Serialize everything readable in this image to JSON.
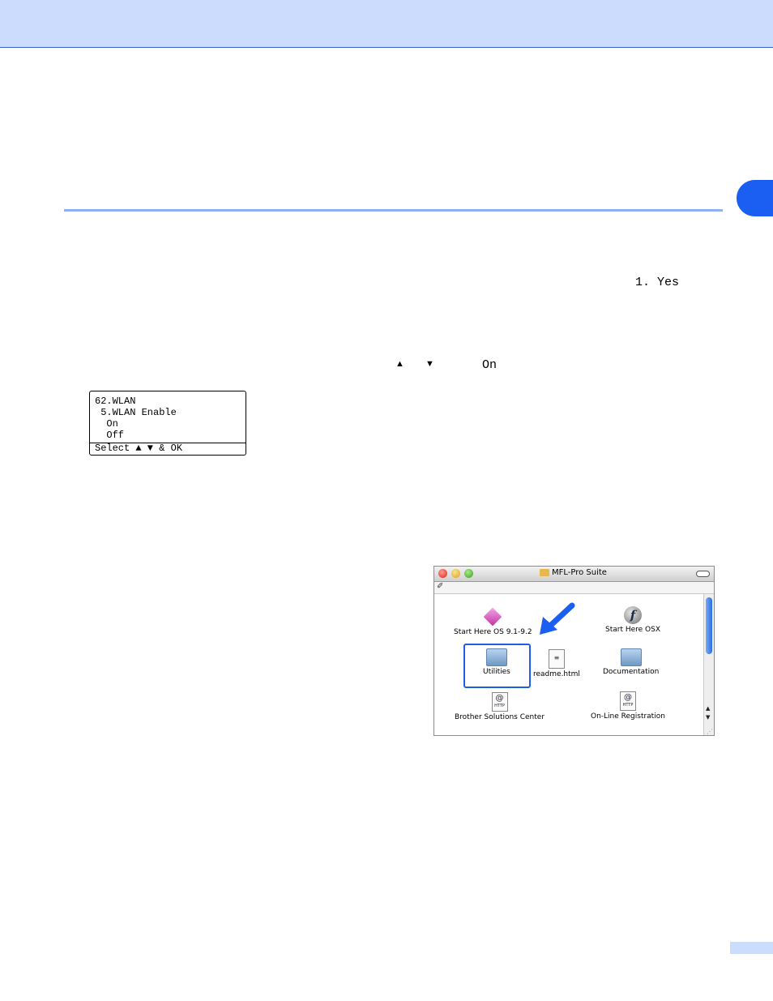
{
  "body": {
    "option_text": "1. Yes",
    "arrow_up": "▲",
    "arrow_down": "▼",
    "on_text": "On"
  },
  "lcd": {
    "line1": "62.WLAN",
    "line2": " 5.WLAN Enable",
    "line3": "  On",
    "line4": "  Off",
    "footer": "Select ▲ ▼ & OK"
  },
  "finder": {
    "window_title": "MFL-Pro Suite",
    "items": [
      {
        "label": "Start Here OS 9.1-9.2",
        "icon": "installer-diamond-icon"
      },
      {
        "label": "Start Here OSX",
        "icon": "flash-f-icon"
      },
      {
        "label": "Utilities",
        "icon": "folder-icon",
        "selected": true
      },
      {
        "label": "readme.html",
        "icon": "document-icon"
      },
      {
        "label": "Documentation",
        "icon": "folder-icon"
      },
      {
        "label": "Brother Solutions Center",
        "icon": "http-link-icon"
      },
      {
        "label": "On-Line Registration",
        "icon": "http-link-icon"
      }
    ],
    "http_icon_text": "@",
    "http_icon_sub": "HTTP"
  },
  "colors": {
    "header_band": "#cbdcfc",
    "accent_blue": "#1a5ff2",
    "rule": "#8fb0f2"
  }
}
